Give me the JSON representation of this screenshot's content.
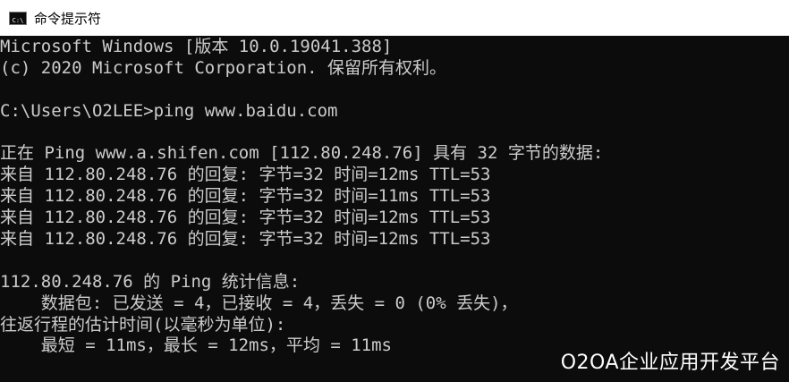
{
  "window": {
    "title": "命令提示符",
    "icon": "cmd-icon",
    "icon_glyph": "C:\\"
  },
  "console": {
    "lines": [
      "Microsoft Windows [版本 10.0.19041.388]",
      "(c) 2020 Microsoft Corporation. 保留所有权利。",
      "",
      "C:\\Users\\O2LEE>ping www.baidu.com",
      "",
      "正在 Ping www.a.shifen.com [112.80.248.76] 具有 32 字节的数据:",
      "来自 112.80.248.76 的回复: 字节=32 时间=12ms TTL=53",
      "来自 112.80.248.76 的回复: 字节=32 时间=11ms TTL=53",
      "来自 112.80.248.76 的回复: 字节=32 时间=12ms TTL=53",
      "来自 112.80.248.76 的回复: 字节=32 时间=12ms TTL=53",
      "",
      "112.80.248.76 的 Ping 统计信息:",
      "    数据包: 已发送 = 4，已接收 = 4，丢失 = 0 (0% 丢失)，",
      "往返行程的估计时间(以毫秒为单位):",
      "    最短 = 11ms，最长 = 12ms，平均 = 11ms"
    ]
  },
  "watermark": {
    "text": "O2OA企业应用开发平台"
  },
  "colors": {
    "console_background": "#0c0c0c",
    "console_text": "#cccccc",
    "titlebar_background": "#ffffff"
  }
}
